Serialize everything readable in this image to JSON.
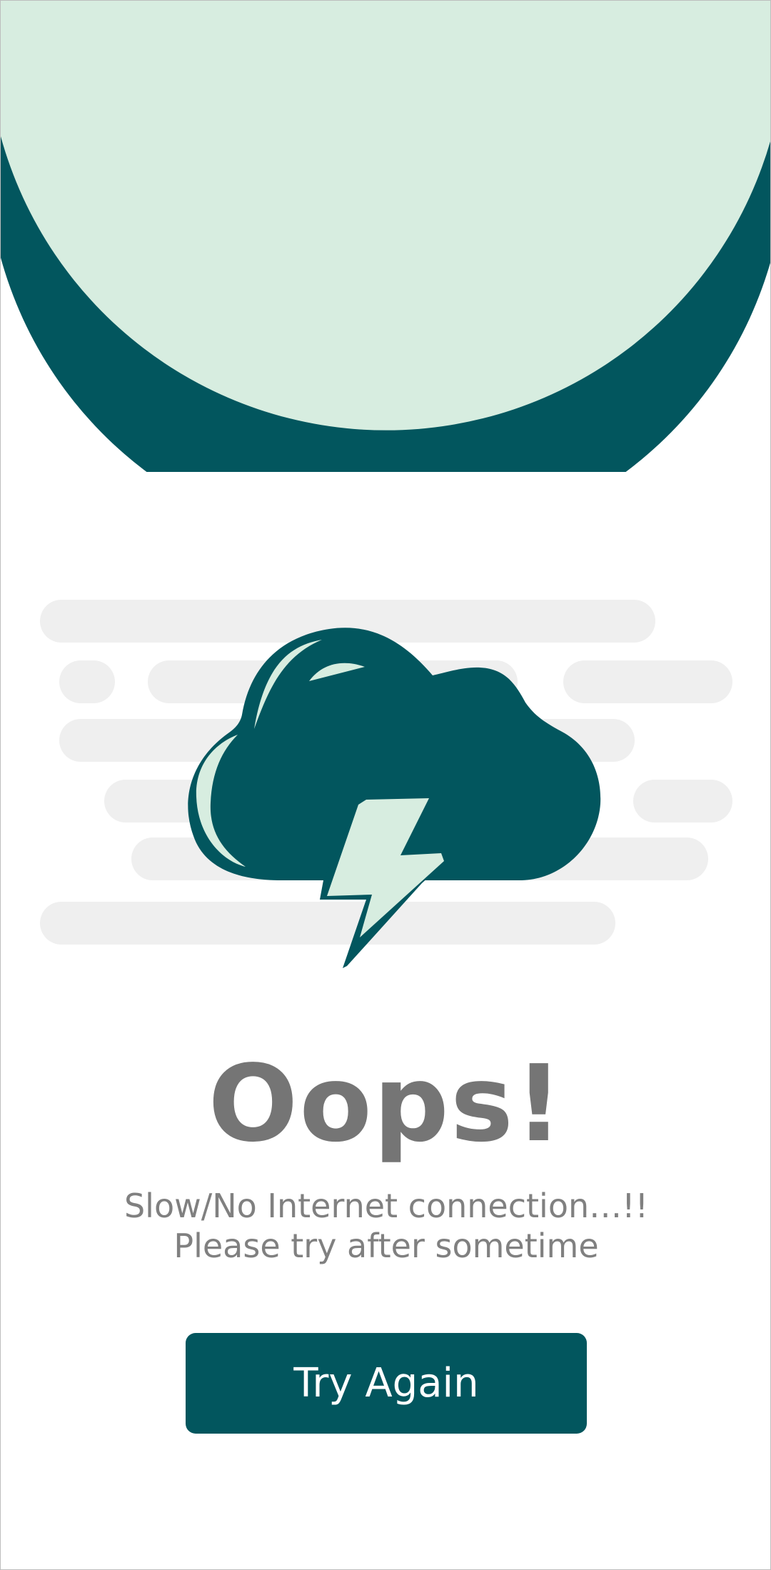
{
  "colors": {
    "teal": "#02565e",
    "mint": "#d7ede0",
    "placeholder_gray": "#efefef",
    "text_gray": "#757575"
  },
  "illustration": {
    "icon": "cloud-lightning-icon"
  },
  "error": {
    "title": "Oops!",
    "message_line1": "Slow/No Internet connection…!!",
    "message_line2": "Please try after sometime"
  },
  "actions": {
    "try_again_label": "Try Again"
  }
}
